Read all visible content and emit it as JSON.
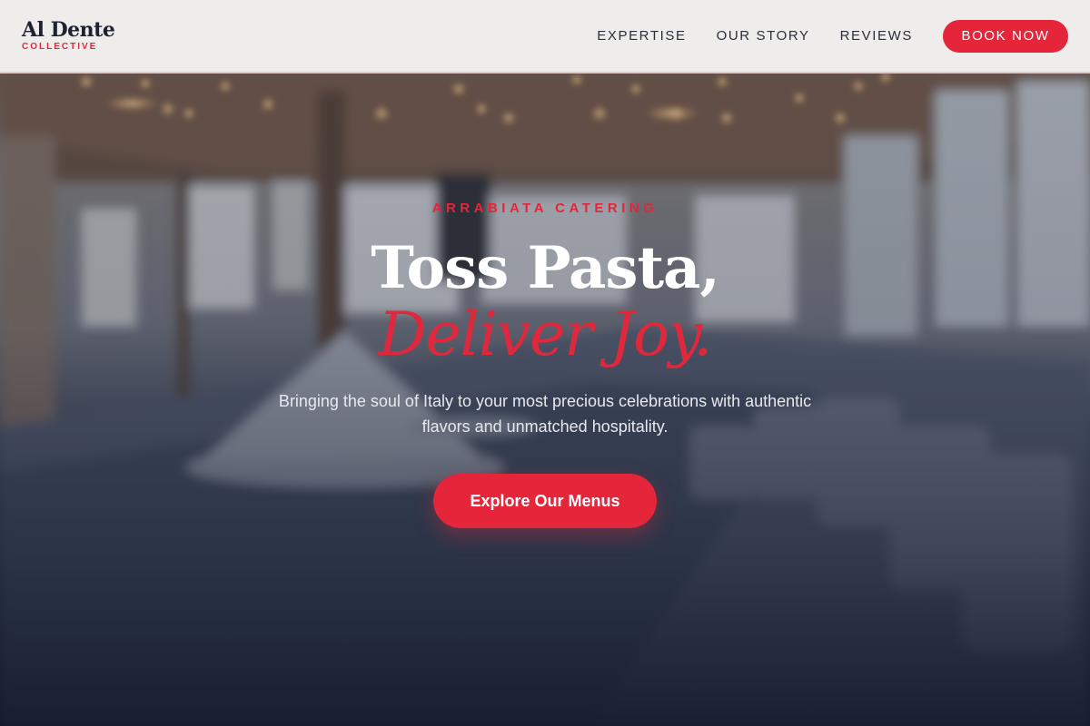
{
  "header": {
    "logo_title": "Al Dente",
    "logo_subtitle": "COLLECTIVE",
    "nav": [
      {
        "label": "EXPERTISE"
      },
      {
        "label": "OUR STORY"
      },
      {
        "label": "REVIEWS"
      }
    ],
    "cta_label": "BOOK NOW"
  },
  "hero": {
    "eyebrow": "ARRABIATA CATERING",
    "title_line1": "Toss Pasta,",
    "title_line2": "Deliver Joy.",
    "subtitle": "Bringing the soul of Italy to your most precious celebrations with authentic flavors and unmatched hospitality.",
    "cta_label": "Explore Our Menus"
  },
  "colors": {
    "accent": "#e4253a",
    "header_bg": "#efedec",
    "dark_text": "#1d2233",
    "hero_dark": "#1a2034"
  }
}
